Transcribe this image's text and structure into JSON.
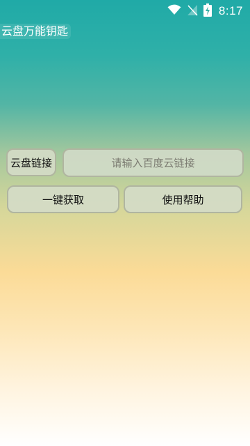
{
  "status_bar": {
    "time": "8:17",
    "icons": [
      "wifi-icon",
      "no-signal-icon",
      "battery-charging-icon"
    ]
  },
  "app": {
    "title": "云盘万能钥匙"
  },
  "form": {
    "link_label": "云盘链接",
    "link_placeholder": "请输入百度云链接",
    "link_value": ""
  },
  "actions": {
    "get_label": "一键获取",
    "help_label": "使用帮助"
  }
}
